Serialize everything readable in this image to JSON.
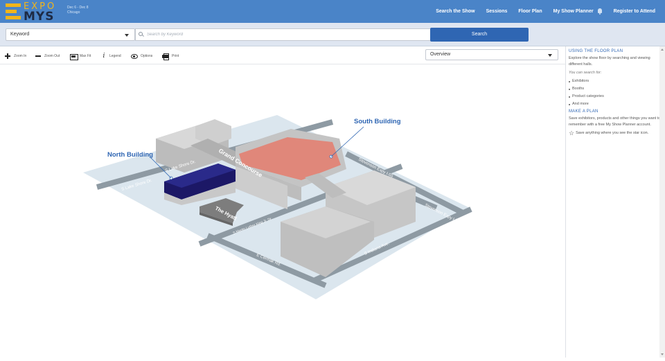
{
  "header": {
    "logo_top": "EXPO",
    "logo_bottom": "MYS",
    "event_dates": "Dec 6 - Dec 8",
    "event_city": "Chicago",
    "nav": [
      {
        "label": "Search the Show"
      },
      {
        "label": "Sessions"
      },
      {
        "label": "Floor Plan"
      },
      {
        "label": "My Show Planner"
      },
      {
        "label": "Register to Attend"
      }
    ]
  },
  "search": {
    "type_value": "Keyword",
    "placeholder": "Search by Keyword",
    "button_label": "Search"
  },
  "toolbar": {
    "zoom_in": "Zoom In",
    "zoom_out": "Zoom Out",
    "max_fit": "Max Fit",
    "legend": "Legend",
    "options": "Options",
    "print": "Print",
    "view_select": "Overview"
  },
  "map": {
    "north_building": "North Building",
    "south_building": "South Building",
    "grand_concourse": "Grand Concourse",
    "the_hyatt": "The Hyatt",
    "streets": {
      "lake_shore_1": "S Lake Shore Dr.",
      "lake_shore_2": "S Lake Shore Dr.",
      "stevenson_1": "Stevenson Expy I-55",
      "stevenson_2": "Stevenson Expy I-55",
      "mlk": "S Martin Luther King Jr. Dr.",
      "cermak": "E Cermak Rd.",
      "indiana": "S Indiana Ave."
    },
    "colors": {
      "north_highlight": "#1c1866",
      "south_highlight": "#e0877a",
      "road": "#8e9aa3",
      "ground": "#dbe6ee"
    }
  },
  "sidebar": {
    "heading1": "USING THE FLOOR PLAN",
    "intro": "Explore the show floor by searching and viewing different halls.",
    "search_for": "You can search for:",
    "items": [
      "Exhibitors",
      "Booths",
      "Product categories",
      "And more"
    ],
    "heading2": "MAKE A PLAN",
    "plan_text": "Save exhibitors, products and other things you want to remember with a free My Show Planner account.",
    "star_text": "Save anything where you see the star icon."
  }
}
